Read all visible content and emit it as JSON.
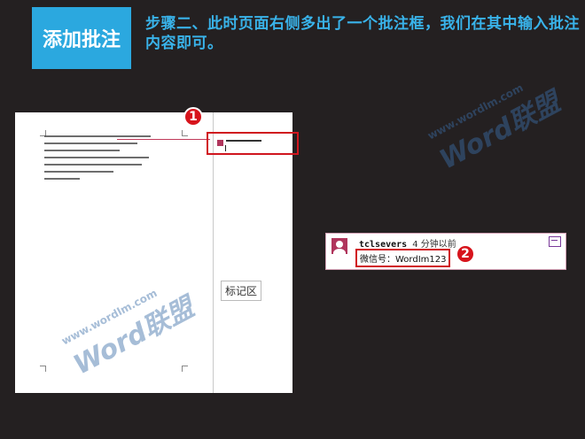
{
  "header": {
    "title": "添加批注",
    "step_text": "步骤二、此时页面右侧多出了一个批注框，我们在其中输入批注内容即可。"
  },
  "callouts": {
    "one": "1",
    "two": "2"
  },
  "document": {
    "markup_area_label": "标记区"
  },
  "comment": {
    "author": "tclsevers",
    "time": "4 分钟以前",
    "body": "微信号：WordIm123"
  },
  "watermark": {
    "text": "Word联盟",
    "url": "www.wordlm.com"
  },
  "colors": {
    "accent": "#2ba8df",
    "highlight": "#d7141c",
    "avatar": "#b0355c"
  }
}
